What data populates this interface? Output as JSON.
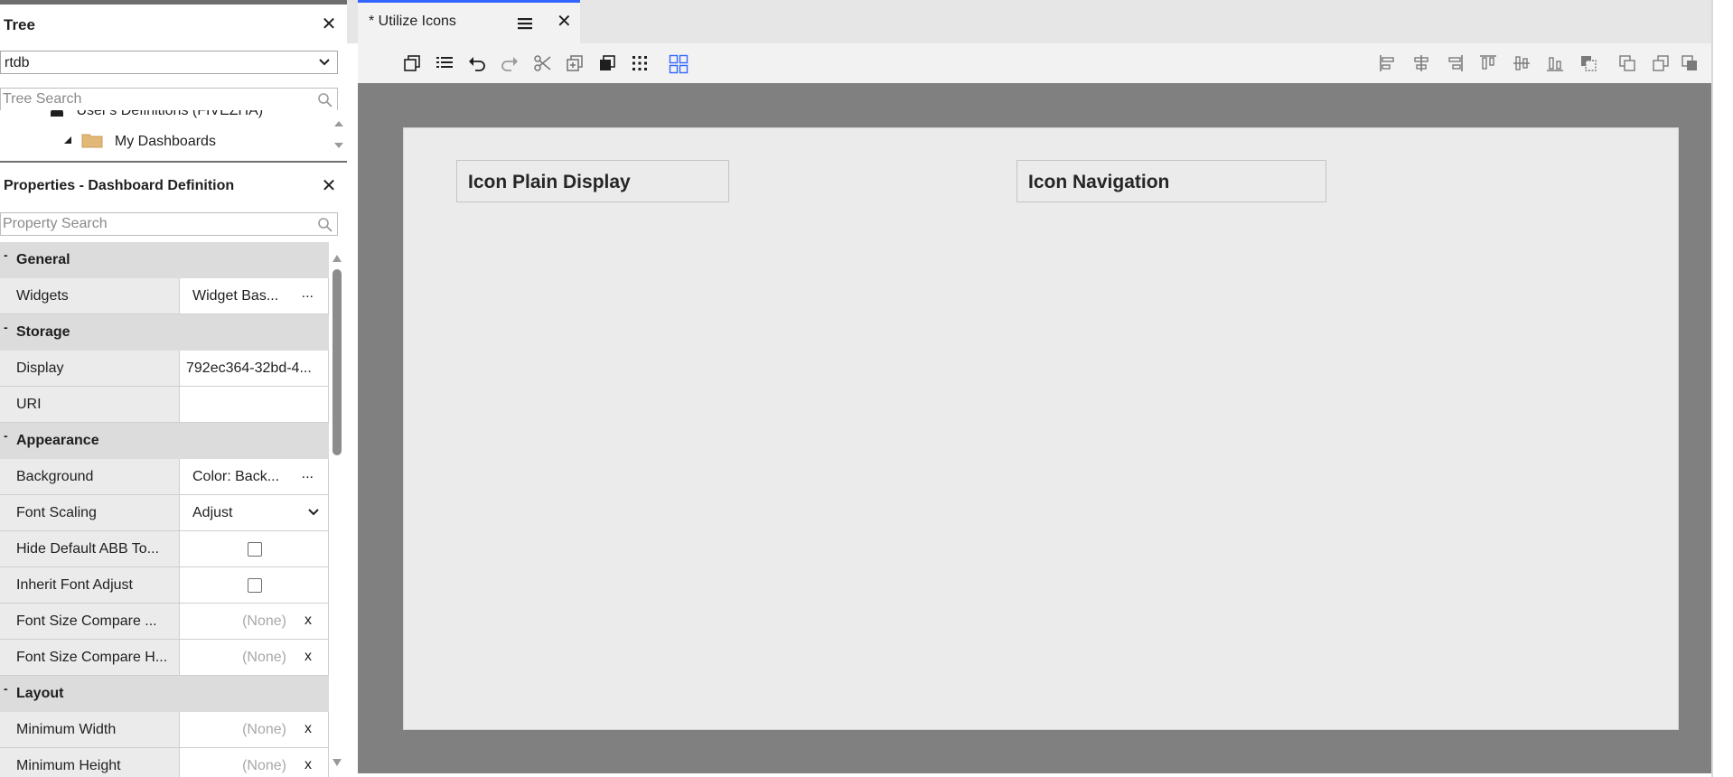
{
  "tree_panel": {
    "title": "Tree",
    "database_value": "rtdb",
    "search_placeholder": "Tree Search",
    "items": [
      {
        "label": "User's Definitions (FIVEZHA)"
      },
      {
        "label": "My Dashboards"
      }
    ]
  },
  "properties_panel": {
    "title": "Properties - Dashboard Definition",
    "search_placeholder": "Property Search",
    "sections": [
      {
        "toggle": "-",
        "label": "General"
      },
      {
        "toggle": "-",
        "label": "Storage"
      },
      {
        "toggle": "-",
        "label": "Appearance"
      },
      {
        "toggle": "-",
        "label": "Layout"
      }
    ],
    "properties": {
      "widgets": {
        "name": "Widgets",
        "value": "Widget Bas...",
        "more": "..."
      },
      "display": {
        "name": "Display",
        "value": "792ec364-32bd-4..."
      },
      "uri": {
        "name": "URI",
        "value": ""
      },
      "background": {
        "name": "Background",
        "value": "Color: Back...",
        "more": "..."
      },
      "font_scaling": {
        "name": "Font Scaling",
        "value": "Adjust"
      },
      "hide_default": {
        "name": "Hide Default ABB To...",
        "checked": false
      },
      "inherit_font": {
        "name": "Inherit Font Adjust",
        "checked": false
      },
      "font_compare_w": {
        "name": "Font Size Compare ...",
        "value": "(None)",
        "clear": "x"
      },
      "font_compare_h": {
        "name": "Font Size Compare H...",
        "value": "(None)",
        "clear": "x"
      },
      "min_width": {
        "name": "Minimum Width",
        "value": "(None)",
        "clear": "x"
      },
      "min_height": {
        "name": "Minimum Height",
        "value": "(None)",
        "clear": "x"
      }
    }
  },
  "editor": {
    "tab_title": "* Utilize Icons",
    "widgets": [
      {
        "title": "Icon Plain Display"
      },
      {
        "title": "Icon Navigation"
      }
    ]
  },
  "colors": {
    "accent_blue": "#3366ff",
    "canvas_gray": "#808080",
    "panel_border": "#6e6e6e"
  }
}
